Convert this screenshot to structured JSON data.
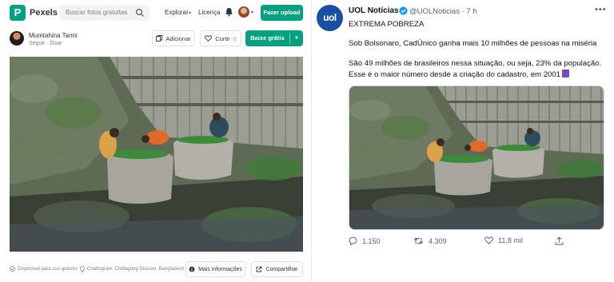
{
  "pexels": {
    "brand": "Pexels",
    "search": {
      "placeholder": "Buscar fotos gratuitas"
    },
    "nav": {
      "explore": "Explorar",
      "license": "Licença"
    },
    "upload_label": "Fazer upload",
    "author": {
      "name": "Mumtahina Tanni",
      "sub": "Seguir · Doar"
    },
    "collect_label": "Adicionar",
    "like_label": "Curtir",
    "like_count": "0",
    "download_label": "Baixe grátis",
    "footer": {
      "free_label": "Disponível para uso gratuito",
      "location": "Chattogram, Chittagong Division, Bangladesh",
      "more_info_label": "Mais informações",
      "share_label": "Compartilhar"
    }
  },
  "tweet": {
    "avatar_text": "uol",
    "name": "UOL Notícias",
    "handle": "@UOLNoticias · 7 h",
    "lines": {
      "l1": "EXTREMA POBREZA",
      "l2": "Sob Bolsonaro, CadÚnico ganha mais 10 milhões de pessoas na miséria",
      "l3": "São 49 milhões de brasileiros nessa situação, ou seja, 23% da população.",
      "l4": "Esse é o maior número desde a criação do cadastro, em 2001"
    },
    "actions": {
      "replies": "1.150",
      "retweets": "4.309",
      "likes": "11,8 mil"
    }
  },
  "colors": {
    "pexels_green": "#05a081",
    "uol_blue": "#1b4fa0",
    "twitter_verified": "#1d9bf0"
  }
}
